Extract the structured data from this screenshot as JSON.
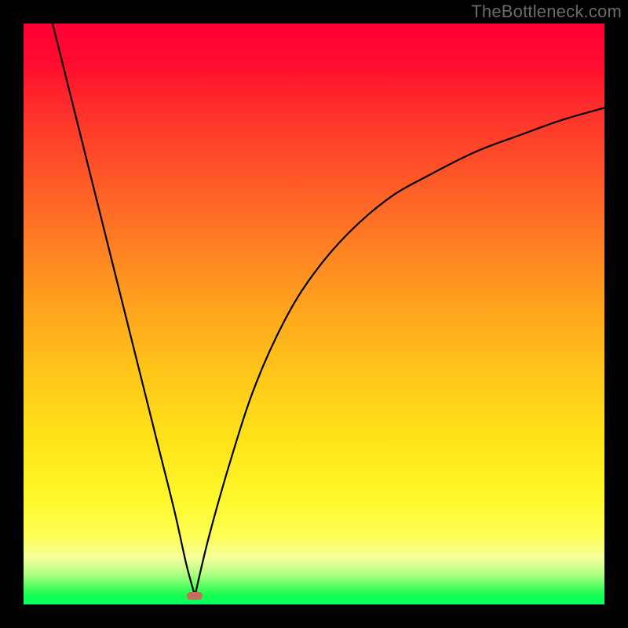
{
  "watermark": "TheBottleneck.com",
  "chart_data": {
    "type": "line",
    "title": "",
    "xlabel": "",
    "ylabel": "",
    "xlim": [
      0,
      1
    ],
    "ylim": [
      0,
      1
    ],
    "legend": false,
    "grid": false,
    "background": "vertical-gradient red→green",
    "min_point": {
      "x": 0.295,
      "y": 0.015
    },
    "min_marker_color": "#c86a5e",
    "series": [
      {
        "name": "left-branch",
        "x": [
          0.05,
          0.08,
          0.11,
          0.14,
          0.17,
          0.2,
          0.23,
          0.26,
          0.28,
          0.295
        ],
        "y": [
          1.0,
          0.88,
          0.76,
          0.64,
          0.52,
          0.4,
          0.28,
          0.16,
          0.07,
          0.015
        ]
      },
      {
        "name": "right-branch",
        "x": [
          0.295,
          0.32,
          0.36,
          0.4,
          0.45,
          0.5,
          0.56,
          0.63,
          0.7,
          0.78,
          0.86,
          0.93,
          1.0
        ],
        "y": [
          0.015,
          0.12,
          0.26,
          0.38,
          0.49,
          0.57,
          0.64,
          0.7,
          0.74,
          0.78,
          0.81,
          0.835,
          0.855
        ]
      }
    ]
  }
}
